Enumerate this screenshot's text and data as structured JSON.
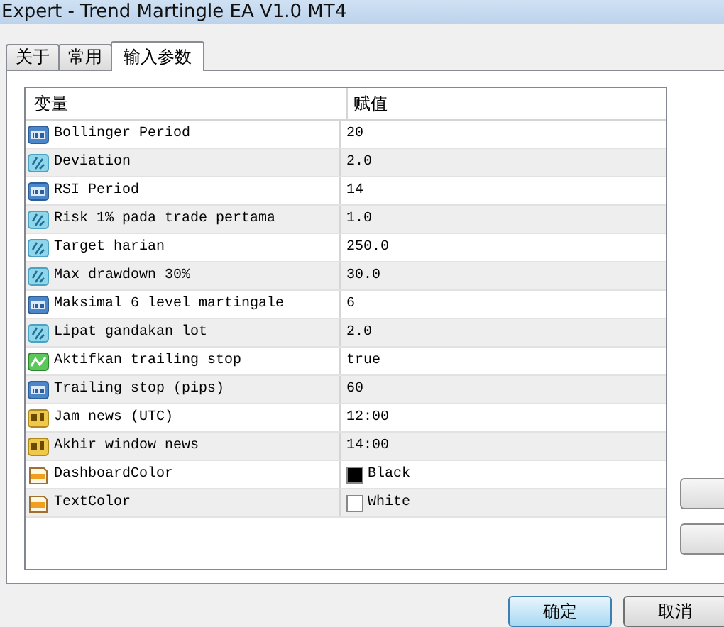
{
  "window": {
    "title": "Expert - Trend Martingle EA V1.0 MT4"
  },
  "tabs": [
    {
      "label": "关于",
      "selected": false
    },
    {
      "label": "常用",
      "selected": false
    },
    {
      "label": "输入参数",
      "selected": true
    }
  ],
  "table": {
    "columns": [
      "变量",
      "赋值"
    ],
    "rows": [
      {
        "kind": "int",
        "name": "Bollinger Period",
        "value": "20"
      },
      {
        "kind": "double",
        "name": "Deviation",
        "value": "2.0"
      },
      {
        "kind": "int",
        "name": "RSI Period",
        "value": "14"
      },
      {
        "kind": "double",
        "name": "Risk 1% pada trade pertama",
        "value": "1.0"
      },
      {
        "kind": "double",
        "name": "Target harian",
        "value": "250.0"
      },
      {
        "kind": "double",
        "name": "Max drawdown 30%",
        "value": "30.0"
      },
      {
        "kind": "int",
        "name": "Maksimal 6 level martingale",
        "value": "6"
      },
      {
        "kind": "double",
        "name": "Lipat gandakan lot",
        "value": "2.0"
      },
      {
        "kind": "bool",
        "name": "Aktifkan trailing stop",
        "value": "true"
      },
      {
        "kind": "int",
        "name": "Trailing stop (pips)",
        "value": "60"
      },
      {
        "kind": "string",
        "name": "Jam news (UTC)",
        "value": "12:00"
      },
      {
        "kind": "string",
        "name": "Akhir window news",
        "value": "14:00"
      },
      {
        "kind": "color",
        "name": "DashboardColor",
        "value": "Black",
        "color": "#000000"
      },
      {
        "kind": "color",
        "name": "TextColor",
        "value": "White",
        "color": "#ffffff"
      }
    ]
  },
  "buttons": [
    {
      "label": "确定",
      "selected": true
    },
    {
      "label": "取消",
      "selected": false
    }
  ]
}
